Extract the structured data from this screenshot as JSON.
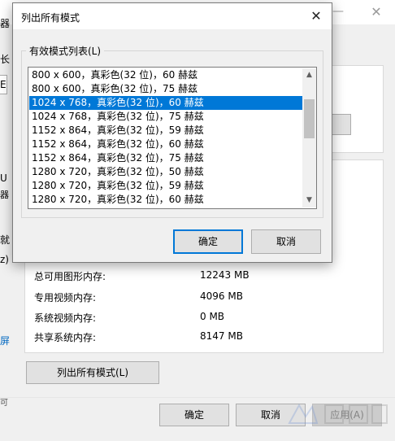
{
  "background_window": {
    "edge_fragments": [
      "器",
      "长",
      "U",
      "器",
      "就",
      "z)",
      "屏",
      "可"
    ],
    "left_input_fragment": "E",
    "info_rows": [
      {
        "label": "总可用图形内存:",
        "value": "12243 MB"
      },
      {
        "label": "专用视频内存:",
        "value": "4096 MB"
      },
      {
        "label": "系统视频内存:",
        "value": "0 MB"
      },
      {
        "label": "共享系统内存:",
        "value": "8147 MB"
      }
    ],
    "list_all_modes_button": "列出所有模式(L)",
    "ok_button": "确定",
    "cancel_button": "取消",
    "apply_button": "应用(A)"
  },
  "dialog": {
    "title": "列出所有模式",
    "group_label": "有效模式列表(L)",
    "modes": [
      {
        "text": "800 x 600，真彩色(32 位)，60 赫兹",
        "selected": false
      },
      {
        "text": "800 x 600，真彩色(32 位)，75 赫兹",
        "selected": false
      },
      {
        "text": "1024 x 768，真彩色(32 位)，60 赫兹",
        "selected": true
      },
      {
        "text": "1024 x 768，真彩色(32 位)，75 赫兹",
        "selected": false
      },
      {
        "text": "1152 x 864，真彩色(32 位)，59 赫兹",
        "selected": false
      },
      {
        "text": "1152 x 864，真彩色(32 位)，60 赫兹",
        "selected": false
      },
      {
        "text": "1152 x 864，真彩色(32 位)，75 赫兹",
        "selected": false
      },
      {
        "text": "1280 x 720，真彩色(32 位)，50 赫兹",
        "selected": false
      },
      {
        "text": "1280 x 720，真彩色(32 位)，59 赫兹",
        "selected": false
      },
      {
        "text": "1280 x 720，真彩色(32 位)，60 赫兹",
        "selected": false
      }
    ],
    "ok_button": "确定",
    "cancel_button": "取消"
  },
  "icons": {
    "close": "close-icon",
    "minimize": "minimize-icon",
    "scroll_up": "chevron-up-icon",
    "scroll_down": "chevron-down-icon"
  },
  "colors": {
    "selection": "#0078d7",
    "link": "#0067c0",
    "window_bg": "#f0f0f0"
  }
}
